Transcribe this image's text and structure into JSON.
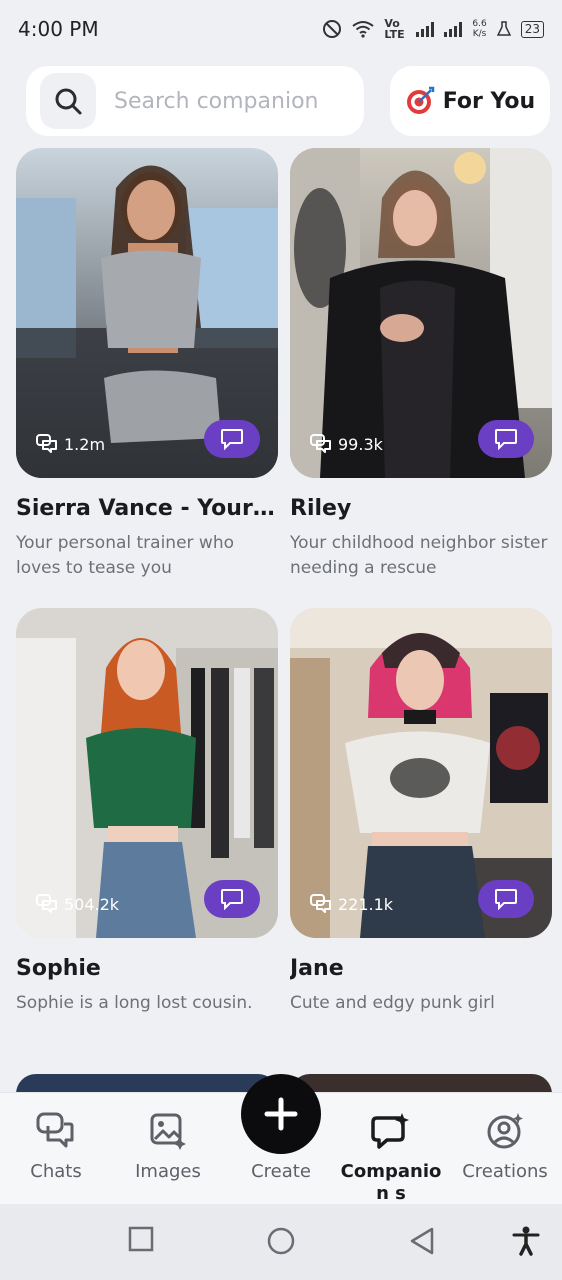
{
  "status_bar": {
    "time": "4:00 PM",
    "network": "Vo LTE",
    "speed_value": "6.6",
    "speed_unit": "K/s",
    "battery": "23"
  },
  "search": {
    "placeholder": "Search companion"
  },
  "filter": {
    "label": "For You"
  },
  "cards": [
    {
      "name": "Sierra Vance - Your P...",
      "description": "Your personal trainer who loves to tease you",
      "chats": "1.2m"
    },
    {
      "name": "Riley",
      "description": "Your childhood neighbor sister needing a rescue",
      "chats": "99.3k"
    },
    {
      "name": "Sophie",
      "description": "Sophie is a long lost cousin.",
      "chats": "504.2k"
    },
    {
      "name": "Jane",
      "description": "Cute and edgy punk girl",
      "chats": "221.1k"
    }
  ],
  "bottom_nav": {
    "chats": "Chats",
    "images": "Images",
    "create": "Create",
    "companions": "Companion s",
    "creations": "Creations"
  },
  "colors": {
    "accent": "#6a3fc4",
    "fab": "#0c0c0f",
    "background": "#eef0f4"
  }
}
